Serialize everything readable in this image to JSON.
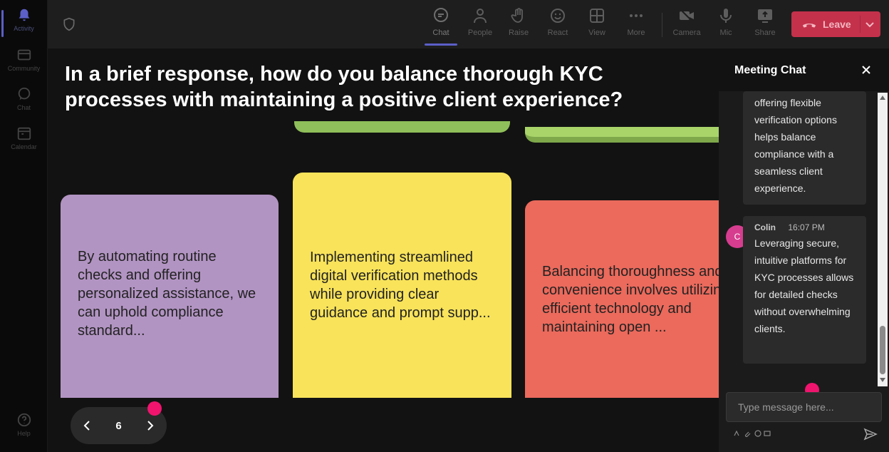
{
  "rail": {
    "items": [
      {
        "label": "Activity",
        "icon": "bell-icon"
      },
      {
        "label": "Community",
        "icon": "community-icon"
      },
      {
        "label": "Chat",
        "icon": "chat-icon"
      },
      {
        "label": "Calendar",
        "icon": "calendar-icon"
      }
    ],
    "help": {
      "label": "Help",
      "icon": "help-icon"
    }
  },
  "toolbar": {
    "chat": "Chat",
    "people": "People",
    "raise": "Raise",
    "react": "React",
    "view": "View",
    "more": "More",
    "camera": "Camera",
    "mic": "Mic",
    "share": "Share",
    "leave": "Leave"
  },
  "stage": {
    "question": "In a brief response, how do you balance thorough KYC processes with maintaining a positive client experience?",
    "cards": [
      {
        "text": "By automating routine checks and offering personalized assistance, we can uphold compliance standard...",
        "color": "#b294c3"
      },
      {
        "text": "Implementing streamlined digital verification methods while providing clear guidance and prompt supp...",
        "color": "#f8e35a"
      },
      {
        "text": "Balancing thoroughness and convenience involves utilizing efficient technology and maintaining open ...",
        "color": "#eb6a5c"
      }
    ],
    "page_number": "6"
  },
  "chat": {
    "title": "Meeting Chat",
    "messages": [
      {
        "text": "offering flexible verification options helps balance compliance with a seamless client experience."
      },
      {
        "author": "Colin",
        "time": "16:07 PM",
        "avatar": "C",
        "text": "Leveraging secure, intuitive platforms for KYC processes allows for detailed checks without overwhelming clients."
      }
    ],
    "input_placeholder": "Type message here..."
  },
  "colors": {
    "accent": "#5b5fc7",
    "leave": "#c4314b",
    "pink_dot": "#f0146e",
    "avatar": "#d63d8f"
  }
}
